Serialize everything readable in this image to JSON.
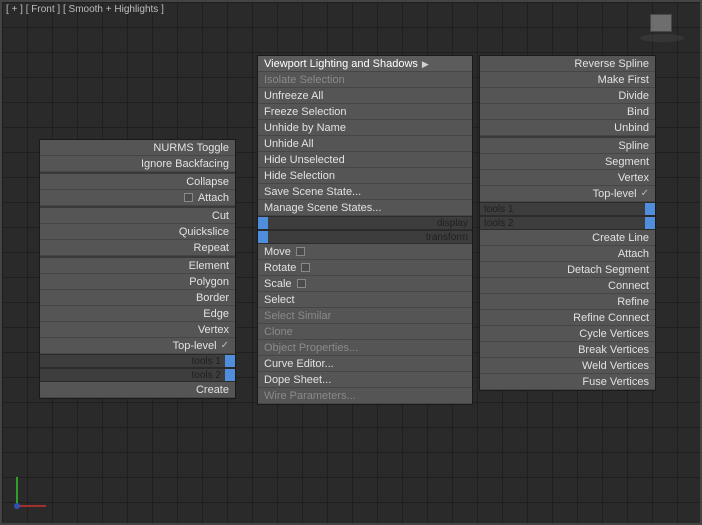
{
  "viewport_label": "[ + ] [ Front ] [ Smooth + Highlights ]",
  "handles": {
    "tools1": "tools 1",
    "tools2": "tools 2",
    "display": "display",
    "transform": "transform"
  },
  "left": {
    "top": [
      "NURMS Toggle",
      "Ignore Backfacing"
    ],
    "mid": [
      "Collapse",
      "Attach"
    ],
    "mid2": [
      "Cut",
      "Quickslice",
      "Repeat"
    ],
    "sub": [
      "Element",
      "Polygon",
      "Border",
      "Edge",
      "Vertex",
      "Top-level"
    ],
    "bottom": [
      "Create"
    ]
  },
  "mid": {
    "g1": [
      {
        "t": "Viewport Lighting and Shadows",
        "arrow": true,
        "hl": true
      },
      {
        "t": "Isolate Selection",
        "disabled": true
      },
      {
        "t": "Unfreeze All"
      },
      {
        "t": "Freeze Selection"
      },
      {
        "t": "Unhide by Name"
      },
      {
        "t": "Unhide All"
      },
      {
        "t": "Hide Unselected"
      },
      {
        "t": "Hide Selection"
      },
      {
        "t": "Save Scene State..."
      },
      {
        "t": "Manage Scene States..."
      }
    ],
    "g2": [
      {
        "t": "Move",
        "box": true
      },
      {
        "t": "Rotate",
        "box": true
      },
      {
        "t": "Scale",
        "box": true
      },
      {
        "t": "Select"
      },
      {
        "t": "Select Similar",
        "disabled": true
      },
      {
        "t": "Clone",
        "disabled": true
      },
      {
        "t": "Object Properties...",
        "disabled": true
      },
      {
        "t": "Curve Editor..."
      },
      {
        "t": "Dope Sheet..."
      },
      {
        "t": "Wire Parameters...",
        "disabled": true
      }
    ]
  },
  "right": {
    "g1": [
      "Reverse Spline",
      "Make First",
      "Divide",
      "Bind",
      "Unbind"
    ],
    "g2": [
      "Spline",
      "Segment",
      "Vertex",
      "Top-level"
    ],
    "g3": [
      "Create Line",
      "Attach",
      "Detach Segment",
      "Connect",
      "Refine",
      "Refine Connect",
      "Cycle Vertices",
      "Break Vertices",
      "Weld Vertices",
      "Fuse Vertices"
    ]
  }
}
